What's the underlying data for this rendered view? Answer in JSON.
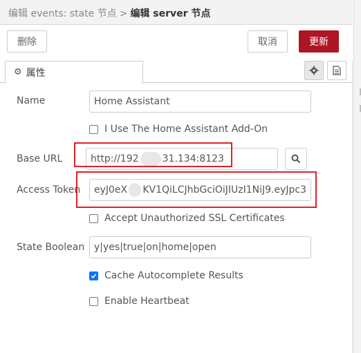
{
  "header": {
    "breadcrumb_parent": "编辑 events: state 节点",
    "separator": ">",
    "breadcrumb_current": "编辑 server 节点"
  },
  "toolbar": {
    "delete_label": "删除",
    "cancel_label": "取消",
    "update_label": "更新"
  },
  "tabs": {
    "properties_label": "属性"
  },
  "form": {
    "name_label": "Name",
    "name_value": "Home Assistant",
    "addon_label": "I Use The Home Assistant Add-On",
    "addon_checked": false,
    "base_url_label": "Base URL",
    "base_url_value_start": "http://192",
    "base_url_value_end": "31.134:8123",
    "access_token_label": "Access Token",
    "access_token_value_start": "eyJ0eX",
    "access_token_value_end": "KV1QiLCJhbGciOiJIUzI1NiJ9.eyJpc3",
    "unauthorized_ssl_label": "Accept Unauthorized SSL Certificates",
    "unauthorized_ssl_checked": false,
    "state_boolean_label": "State Boolean",
    "state_boolean_value": "y|yes|true|on|home|open",
    "cache_label": "Cache Autocomplete Results",
    "cache_checked": true,
    "heartbeat_label": "Enable Heartbeat",
    "heartbeat_checked": false
  },
  "colors": {
    "update_button": "#ad1625",
    "highlight_box": "#e0202a",
    "checkbox_checked": "#0075ff"
  },
  "icons": [
    "gear-icon",
    "document-icon",
    "search-icon",
    "check-icon"
  ]
}
